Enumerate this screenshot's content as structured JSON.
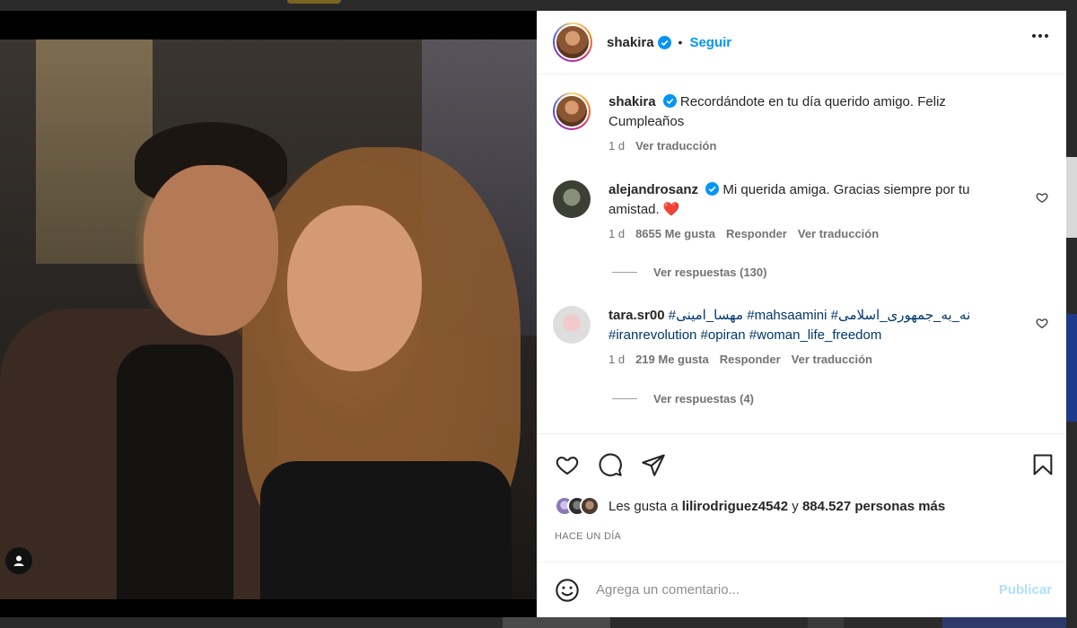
{
  "post": {
    "author": "shakira",
    "follow_label": "Seguir",
    "dot": "•"
  },
  "caption": {
    "username": "shakira",
    "text": "Recordándote en tu día querido amigo. Feliz Cumpleaños",
    "time": "1 d",
    "translate": "Ver traducción"
  },
  "comments": [
    {
      "username": "alejandrosanz",
      "text": "Mi querida amiga. Gracias siempre por tu amistad.",
      "emoji": "❤️",
      "time": "1 d",
      "likes": "8655 Me gusta",
      "reply": "Responder",
      "translate": "Ver traducción",
      "replies": "Ver respuestas (130)"
    },
    {
      "username": "tara.sr00",
      "text": "#مهسا_امینی #mahsaamini #نه_به_جمهوری_اسلامی #iranrevolution #opiran #woman_life_freedom",
      "time": "1 d",
      "likes": "219 Me gusta",
      "reply": "Responder",
      "translate": "Ver traducción",
      "replies": "Ver respuestas (4)"
    }
  ],
  "likes": {
    "prefix": "Les gusta a",
    "user": "lilirodriguez4542",
    "connector": "y",
    "others": "884.527 personas más"
  },
  "time_ago": "HACE UN DÍA",
  "composer": {
    "placeholder": "Agrega un comentario...",
    "post_label": "Publicar"
  },
  "colors": {
    "accent": "#0095f6",
    "verified": "#0095f6",
    "muted": "#737373",
    "post_disabled": "#b2dffc"
  },
  "icons": [
    "verified-icon",
    "more-options-icon",
    "heart-icon",
    "comment-icon",
    "share-icon",
    "save-icon",
    "emoji-icon",
    "user-tag-icon"
  ]
}
